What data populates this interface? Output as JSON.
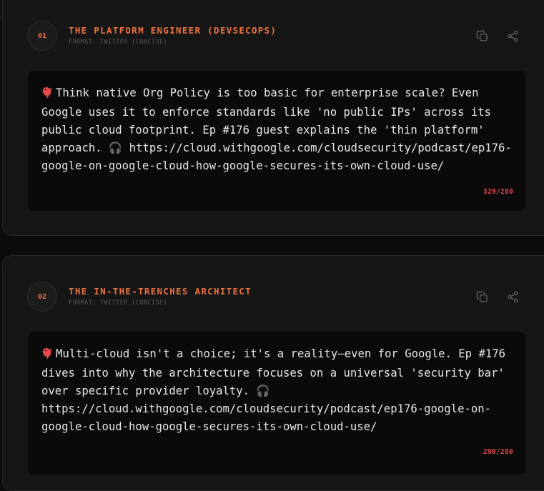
{
  "colors": {
    "accent": "#e8713f",
    "over_limit": "#e5484d",
    "background": "#0c0c0c",
    "card": "#161616",
    "post_box": "#0a0a0a"
  },
  "cards": [
    {
      "index": "01",
      "title": "THE PLATFORM ENGINEER (DEVSECOPS)",
      "format": "FORMAT: TWITTER (CONCISE)",
      "lead_icon": "bird-icon",
      "post_lines": [
        "Think native Org Policy is too basic for enterprise scale? Even",
        "Google uses it to enforce standards like 'no public IPs' across its",
        "public cloud footprint. Ep #176 guest explains the 'thin platform'",
        "approach. 🎧 https://cloud.withgoogle.com/cloudsecurity/podcast/ep176-",
        "google-on-google-cloud-how-google-secures-its-own-cloud-use/"
      ],
      "char_count": "329/280",
      "actions": [
        "copy-icon",
        "share-icon"
      ]
    },
    {
      "index": "02",
      "title": "THE IN-THE-TRENCHES ARCHITECT",
      "format": "FORMAT: TWITTER (CONCISE)",
      "lead_icon": "bird-icon",
      "post_lines": [
        "Multi-cloud isn't a choice; it's a reality—even for Google. Ep #176",
        "dives into why the architecture focuses on a universal 'security bar'",
        "over specific provider loyalty. 🎧",
        "https://cloud.withgoogle.com/cloudsecurity/podcast/ep176-google-on-",
        "google-cloud-how-google-secures-its-own-cloud-use/"
      ],
      "char_count": "290/280",
      "actions": [
        "copy-icon",
        "share-icon"
      ]
    }
  ]
}
